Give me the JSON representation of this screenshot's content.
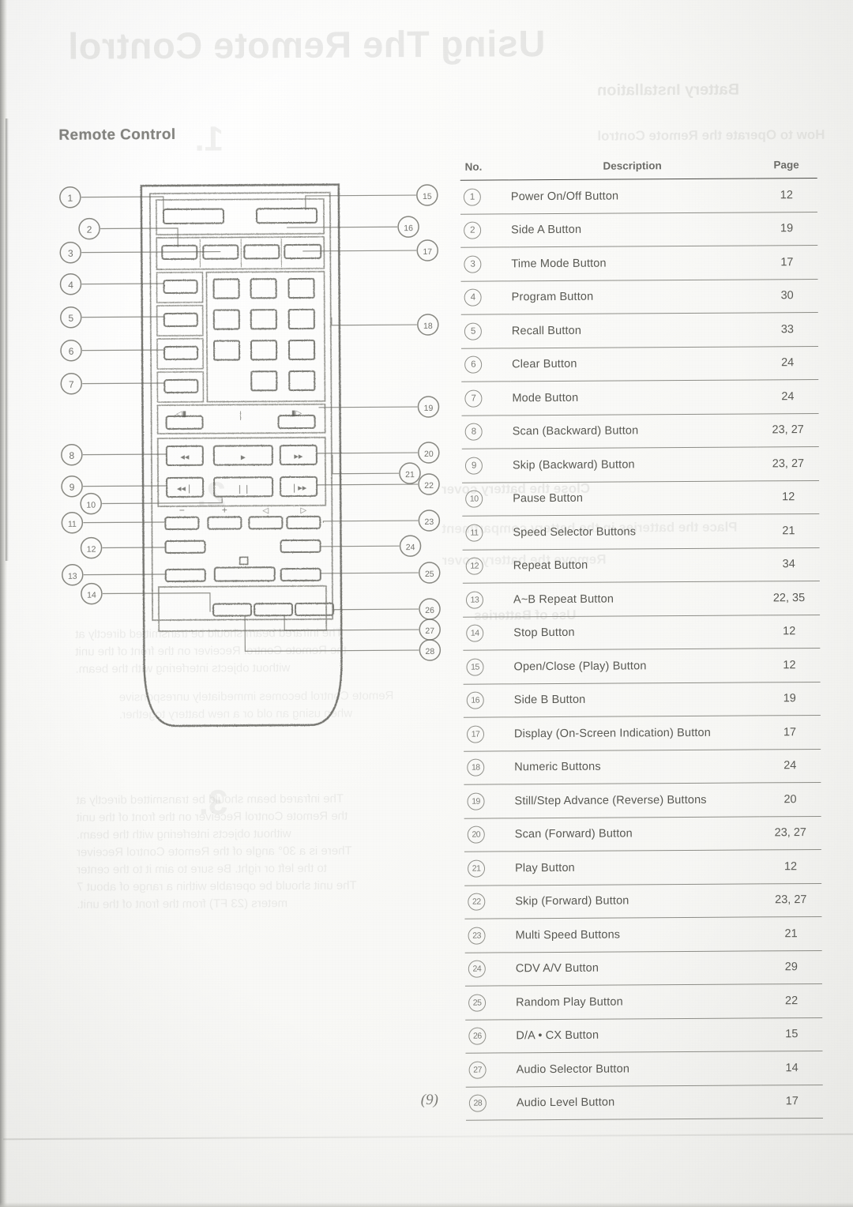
{
  "document": {
    "page_number": "(9)",
    "section_heading": "Remote Control",
    "bleed_through": {
      "title": "Using The Remote Control",
      "subtitle": "Battery Installation",
      "note_1": "The infrared beam should be transmitted directly at",
      "note_2": "the Remote Control Receiver on the front of the unit",
      "note_3": "without objects interfering with the beam.",
      "note_4": "There is a 30° angle of the Remote Control Receiver",
      "note_5": "to the left or right. Be sure to aim it to the center",
      "note_6": "The unit should be operable within a range of about 7",
      "note_7": "meters (23 FT) from the front of the unit.",
      "heading_a": "Use of Batteries",
      "heading_b": "How to Operate the Remote Control",
      "heading_c": "Close the battery cover",
      "heading_d": "Place the batteries in the battery compartment",
      "heading_e": "Remove the battery cover",
      "warn_1": "Remote Control becomes immediately unresponsive",
      "warn_2": "when using an old or a new battery together."
    }
  },
  "table": {
    "headers": {
      "no": "No.",
      "description": "Description",
      "page": "Page"
    },
    "rows": [
      {
        "no": "1",
        "description": "Power On/Off Button",
        "page": "12"
      },
      {
        "no": "2",
        "description": "Side A Button",
        "page": "19"
      },
      {
        "no": "3",
        "description": "Time Mode Button",
        "page": "17"
      },
      {
        "no": "4",
        "description": "Program Button",
        "page": "30"
      },
      {
        "no": "5",
        "description": "Recall Button",
        "page": "33"
      },
      {
        "no": "6",
        "description": "Clear Button",
        "page": "24"
      },
      {
        "no": "7",
        "description": "Mode Button",
        "page": "24"
      },
      {
        "no": "8",
        "description": "Scan (Backward) Button",
        "page": "23, 27"
      },
      {
        "no": "9",
        "description": "Skip (Backward) Button",
        "page": "23, 27"
      },
      {
        "no": "10",
        "description": "Pause Button",
        "page": "12"
      },
      {
        "no": "11",
        "description": "Speed Selector Buttons",
        "page": "21"
      },
      {
        "no": "12",
        "description": "Repeat Button",
        "page": "34"
      },
      {
        "no": "13",
        "description": "A~B Repeat Button",
        "page": "22, 35"
      },
      {
        "no": "14",
        "description": "Stop Button",
        "page": "12"
      },
      {
        "no": "15",
        "description": "Open/Close (Play) Button",
        "page": "12"
      },
      {
        "no": "16",
        "description": "Side B Button",
        "page": "19"
      },
      {
        "no": "17",
        "description": "Display (On-Screen Indication) Button",
        "page": "17"
      },
      {
        "no": "18",
        "description": "Numeric Buttons",
        "page": "24"
      },
      {
        "no": "19",
        "description": "Still/Step Advance (Reverse) Buttons",
        "page": "20"
      },
      {
        "no": "20",
        "description": "Scan (Forward) Button",
        "page": "23, 27"
      },
      {
        "no": "21",
        "description": "Play Button",
        "page": "12"
      },
      {
        "no": "22",
        "description": "Skip (Forward) Button",
        "page": "23, 27"
      },
      {
        "no": "23",
        "description": "Multi Speed Buttons",
        "page": "21"
      },
      {
        "no": "24",
        "description": "CDV A/V Button",
        "page": "29"
      },
      {
        "no": "25",
        "description": "Random Play Button",
        "page": "22"
      },
      {
        "no": "26",
        "description": "D/A • CX Button",
        "page": "15"
      },
      {
        "no": "27",
        "description": "Audio Selector Button",
        "page": "14"
      },
      {
        "no": "28",
        "description": "Audio Level Button",
        "page": "17"
      }
    ]
  },
  "diagram": {
    "callouts_left": [
      "1",
      "2",
      "3",
      "4",
      "5",
      "6",
      "7",
      "8",
      "9",
      "10",
      "11",
      "12",
      "13",
      "14"
    ],
    "callouts_right": [
      "15",
      "16",
      "17",
      "18",
      "19",
      "20",
      "21",
      "22",
      "23",
      "24",
      "25",
      "26",
      "27",
      "28"
    ],
    "speed_labels": [
      "−",
      "+",
      "◁",
      "▷"
    ],
    "step_labels": [
      "◁▮",
      "▮▷"
    ],
    "transport_icons": {
      "scan_back": "◂◂",
      "play": "▸",
      "scan_fwd": "▸▸",
      "skip_back": "◂◂❘",
      "pause": "❘❘",
      "skip_fwd": "❘▸▸",
      "stop": "■"
    }
  },
  "colors": {
    "ink": "#4d4d47",
    "line": "#8e8e88",
    "paper": "#fbfbfa",
    "bleed": "#6a6a66"
  }
}
